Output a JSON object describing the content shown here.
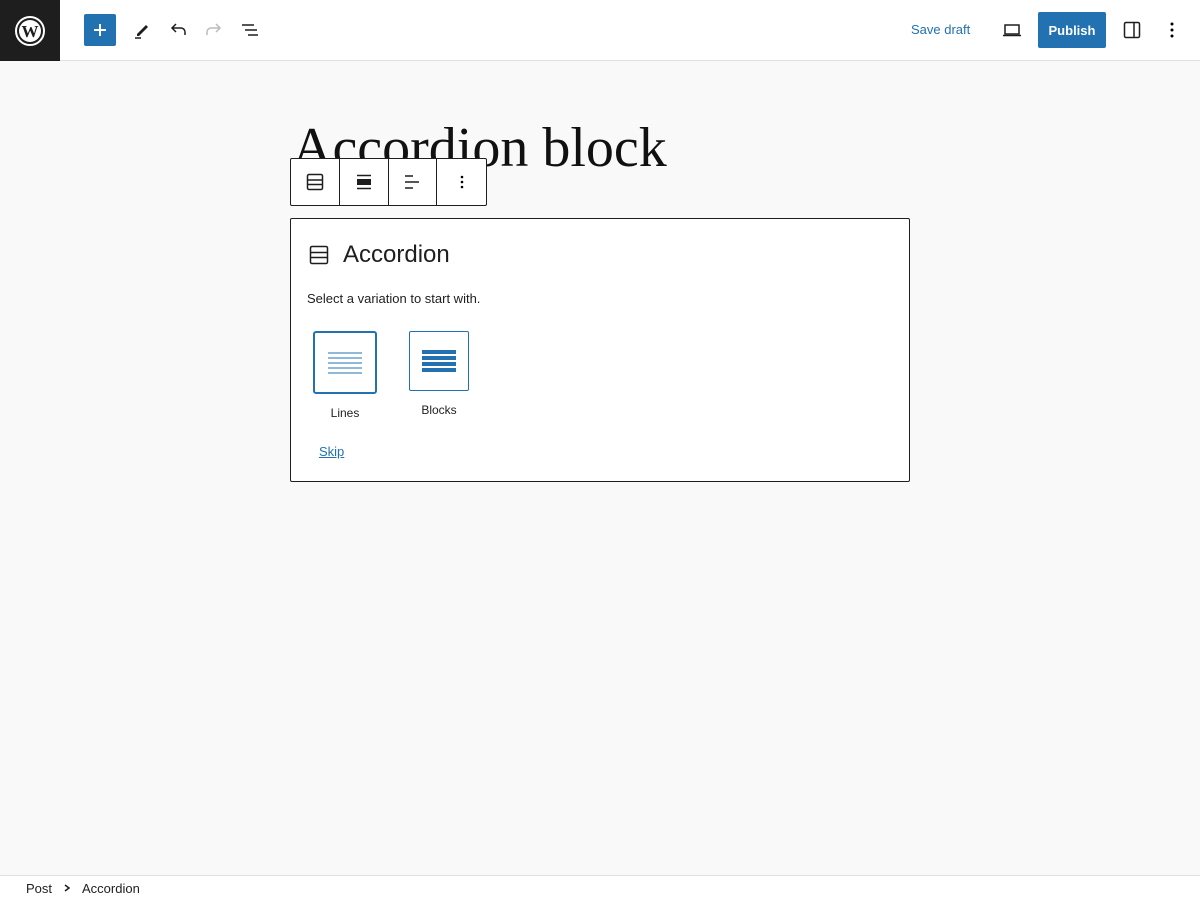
{
  "header": {
    "save_draft": "Save draft",
    "publish": "Publish"
  },
  "post": {
    "title": "Accordion block"
  },
  "placeholder": {
    "title": "Accordion",
    "instructions": "Select a variation to start with.",
    "variations": [
      {
        "label": "Lines"
      },
      {
        "label": "Blocks"
      }
    ],
    "skip": "Skip"
  },
  "breadcrumb": {
    "items": [
      "Post",
      "Accordion"
    ]
  },
  "colors": {
    "accent": "#2271b1"
  }
}
